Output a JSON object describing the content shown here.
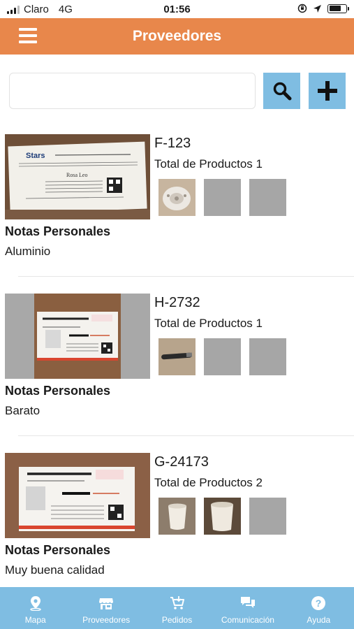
{
  "status": {
    "carrier": "Claro",
    "network": "4G",
    "time": "01:56"
  },
  "header": {
    "title": "Proveedores",
    "menu_icon": "hamburger-icon"
  },
  "search": {
    "value": "",
    "placeholder": "",
    "search_icon": "magnifier-icon",
    "add_icon": "plus-icon"
  },
  "suppliers": [
    {
      "code": "F-123",
      "total": "Total de Productos 1",
      "notes_label": "Notas Personales",
      "notes": "Aluminio",
      "card_text": {
        "brand": "Stars",
        "name": "Rosa Leo"
      }
    },
    {
      "code": "H-2732",
      "total": "Total de Productos 1",
      "notes_label": "Notas Personales",
      "notes": "Barato"
    },
    {
      "code": "G-24173",
      "total": "Total de Productos 2",
      "notes_label": "Notas Personales",
      "notes": "Muy buena calidad"
    }
  ],
  "tabs": [
    {
      "label": "Mapa",
      "icon": "map-pin-icon"
    },
    {
      "label": "Proveedores",
      "icon": "store-icon"
    },
    {
      "label": "Pedidos",
      "icon": "cart-icon"
    },
    {
      "label": "Comunicación",
      "icon": "chat-icon"
    },
    {
      "label": "Ayuda",
      "icon": "help-icon"
    }
  ],
  "colors": {
    "header": "#e8874b",
    "accent": "#7fbde2"
  }
}
